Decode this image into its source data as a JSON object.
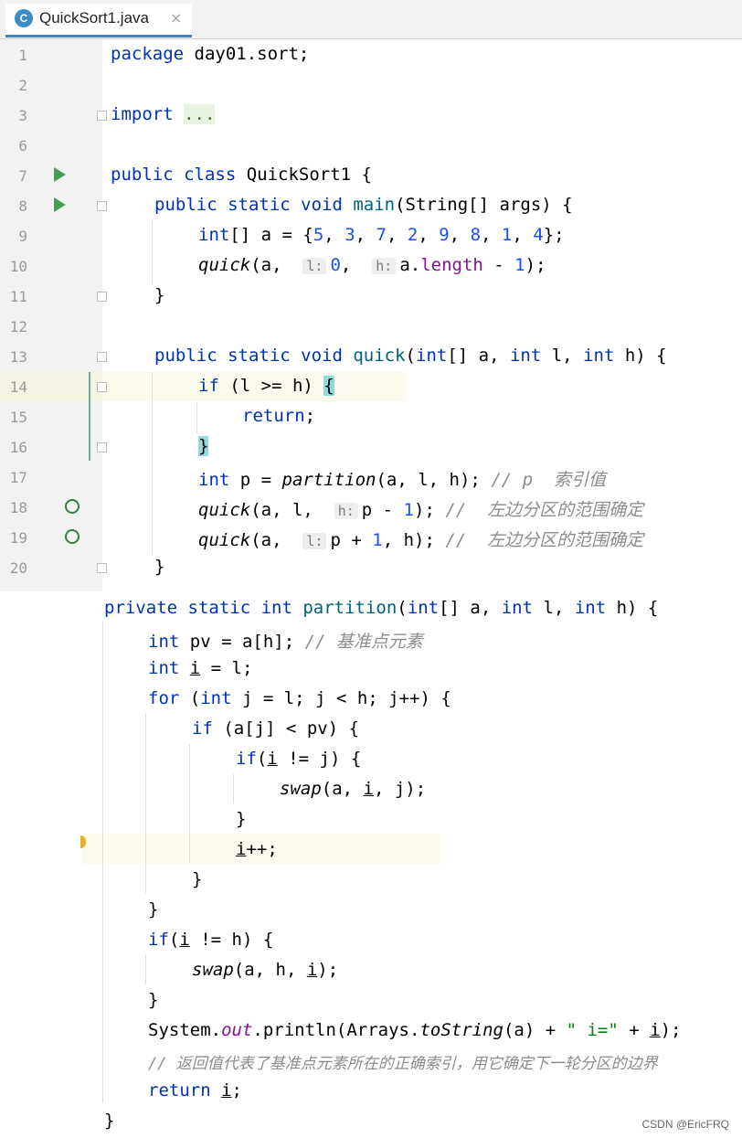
{
  "tab": {
    "icon_letter": "C",
    "title": "QuickSort1.java",
    "close": "×"
  },
  "lines_top": [
    {
      "n": "1"
    },
    {
      "n": "2"
    },
    {
      "n": "3"
    },
    {
      "n": "6"
    },
    {
      "n": "7"
    },
    {
      "n": "8"
    },
    {
      "n": "9"
    },
    {
      "n": "10"
    },
    {
      "n": "11"
    },
    {
      "n": "12"
    },
    {
      "n": "13"
    },
    {
      "n": "14"
    },
    {
      "n": "15"
    },
    {
      "n": "16"
    },
    {
      "n": "17"
    },
    {
      "n": "18"
    },
    {
      "n": "19"
    },
    {
      "n": "20"
    }
  ],
  "code": {
    "pkg": "package",
    "pkg_name": " day01.sort;",
    "import_kw": "import",
    "import_fold": "...",
    "public": "public",
    "class": " class",
    "class_name": " QuickSort1 {",
    "main_sig_kw": "public static void",
    "main_name": " main",
    "main_params": "(String[] args) {",
    "int": "int",
    "arr_decl": "[] a = {",
    "nums": [
      "5",
      "3",
      "7",
      "2",
      "9",
      "8",
      "1",
      "4"
    ],
    "arr_end": "};",
    "quick": "quick",
    "hint_l": "l:",
    "hint_h": "h:",
    "q1_open": "(a,  ",
    "q1_zero": "0",
    "q1_comma": ",  ",
    "q1_a": "a.",
    "q1_length": "length",
    "q1_minus": " - ",
    "q1_one": "1",
    "q1_close": ");",
    "close_brace": "}",
    "quick_sig_kw": "public static void",
    "quick_name": " quick",
    "quick_params_a": "(int",
    "quick_params_b": "[] a, ",
    "quick_params_c": " l, ",
    "quick_params_d": " h) {",
    "if": "if",
    "if_cond": " (l >= h) ",
    "open_brace": "{",
    "return_kw": "return",
    "semi": ";",
    "p_decl": " p = ",
    "partition": "partition",
    "p_args": "(a, l, h); ",
    "cmt_p": "// p  索引值",
    "q18_open": "(a, l,  ",
    "q18_p": "p - ",
    "q18_close": "); ",
    "cmt_left": "//  左边分区的范围确定",
    "q19_open": "(a,  ",
    "q19_p": "p + ",
    "q19_close": ", h); ",
    "private_sig": "private static int",
    "part_name": " partition",
    "part_params": "(int[] a, int l, int h) {",
    "pv_decl": " pv = a[h]; ",
    "cmt_pv": "// 基准点元素",
    "i_decl_a": " ",
    "i_var": "i",
    "i_decl_b": " = l;",
    "for": "for",
    "for_a": " (",
    "for_int": "int",
    "for_b": " j = l; j < h; j++) {",
    "if2": "if",
    "if2_cond": " (a[j] < pv) {",
    "if3": "if",
    "if3_cond_a": "(",
    "if3_cond_b": " != j) {",
    "swap": "swap",
    "swap1_args_a": "(a, ",
    "swap1_args_b": ", j);",
    "i_inc": "++;",
    "if4": "if",
    "if4_cond_a": "(",
    "if4_cond_b": " != h) {",
    "swap2_args_a": "(a, h, ",
    "swap2_args_b": ");",
    "sys_a": "System.",
    "sys_out": "out",
    "sys_b": ".println(Arrays.",
    "to_string": "toString",
    "sys_c": "(a) + ",
    "sys_str": "\" i=\"",
    "sys_d": " + ",
    "sys_e": ");",
    "cmt_return": "// 返回值代表了基准点元素所在的正确索引，用它确定下一轮分区的边界",
    "return2": "return",
    "ret_i_end": ";"
  },
  "watermark": "CSDN @EricFRQ"
}
